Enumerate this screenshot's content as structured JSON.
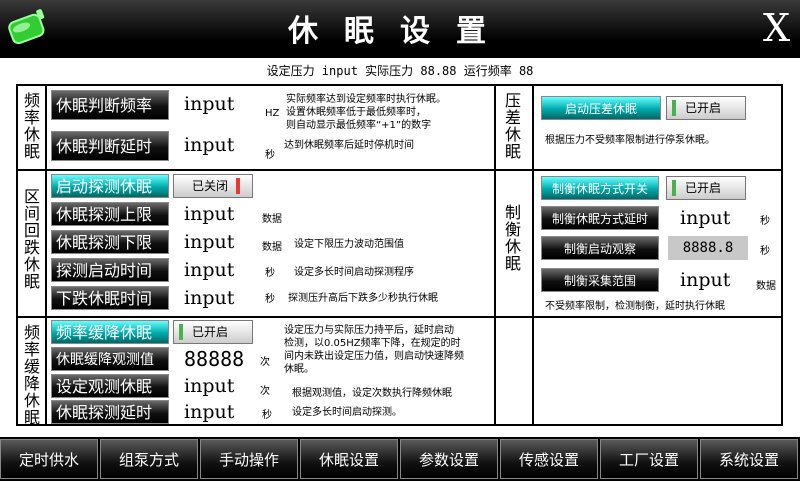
{
  "header": {
    "title": "休眠设置",
    "close": "X"
  },
  "status": "设定压力 input 实际压力 88.88 运行频率  88",
  "sections": {
    "freq_sleep": [
      "频",
      "率",
      "休",
      "眠"
    ],
    "interval_sleep": [
      "区",
      "间",
      "回",
      "跌",
      "休",
      "眠"
    ],
    "freq_slow": [
      "频",
      "率",
      "缓",
      "降",
      "休",
      "眠"
    ],
    "press_diff": [
      "压",
      "差",
      "休",
      "眠"
    ],
    "balance": [
      "制",
      "衡",
      "休",
      "眠"
    ]
  },
  "freq": {
    "judge_freq": {
      "label": "休眠判断频率",
      "value": "input",
      "unit": "HZ"
    },
    "judge_delay": {
      "label": "休眠判断延时",
      "value": "input",
      "unit": "秒"
    },
    "desc1": "实际频率达到设定频率时执行休眠。",
    "desc2": "设置休眠频率低于最低频率时，",
    "desc3": "则自动显示最低频率“+1”的数字",
    "desc4": "达到休眠频率后延时停机时间"
  },
  "interval": {
    "start": {
      "label": "启动探测休眠",
      "toggle": "已关闭"
    },
    "upper": {
      "label": "休眠探测上限",
      "value": "input",
      "unit": "数据"
    },
    "lower": {
      "label": "休眠探测下限",
      "value": "input",
      "unit": "数据",
      "desc": "设定下限压力波动范围值"
    },
    "time": {
      "label": "探测启动时间",
      "value": "input",
      "unit": "秒",
      "desc": "设定多长时间启动探测程序"
    },
    "drop": {
      "label": "下跌休眠时间",
      "value": "input",
      "unit": "秒",
      "desc": "探测压升高后下跌多少秒执行休眠"
    }
  },
  "slow": {
    "enable": {
      "label": "频率缓降休眠",
      "toggle": "已开启"
    },
    "observe": {
      "label": "休眠缓降观测值",
      "value": "88888",
      "unit": "次"
    },
    "set_obs": {
      "label": "设定观测休眠",
      "value": "input",
      "unit": "次",
      "desc": "根据观测值，设定次数执行降频休眠"
    },
    "probe": {
      "label": "休眠探测延时",
      "value": "input",
      "unit": "秒",
      "desc": "设定多长时间启动探测。"
    },
    "desc1": "设定压力与实际压力持平后，延时启动",
    "desc2": "检测，以0.05HZ频率下降，在规定的时",
    "desc3": "间内未跌出设定压力值，则启动快速降频",
    "desc4": "休眠。"
  },
  "pressure": {
    "label": "启动压差休眠",
    "toggle": "已开启",
    "desc": "根据压力不受频率限制进行停泵休眠。"
  },
  "balance": {
    "switch": {
      "label": "制衡休眠方式开关",
      "toggle": "已开启"
    },
    "delay": {
      "label": "制衡休眠方式延时",
      "value": "input",
      "unit": "秒"
    },
    "observe": {
      "label": "制衡启动观察",
      "value": "8888.8",
      "unit": "秒"
    },
    "range": {
      "label": "制衡采集范围",
      "value": "input",
      "unit": "数据"
    },
    "desc": "不受频率限制，检测制衡，延时执行休眠"
  },
  "nav": [
    "定时供水",
    "组泵方式",
    "手动操作",
    "休眠设置",
    "参数设置",
    "传感设置",
    "工厂设置",
    "系统设置"
  ],
  "colors": {
    "toggle_on": "#4caf50",
    "toggle_off": "#e53935",
    "accent_cyan": "#00b3b3"
  }
}
